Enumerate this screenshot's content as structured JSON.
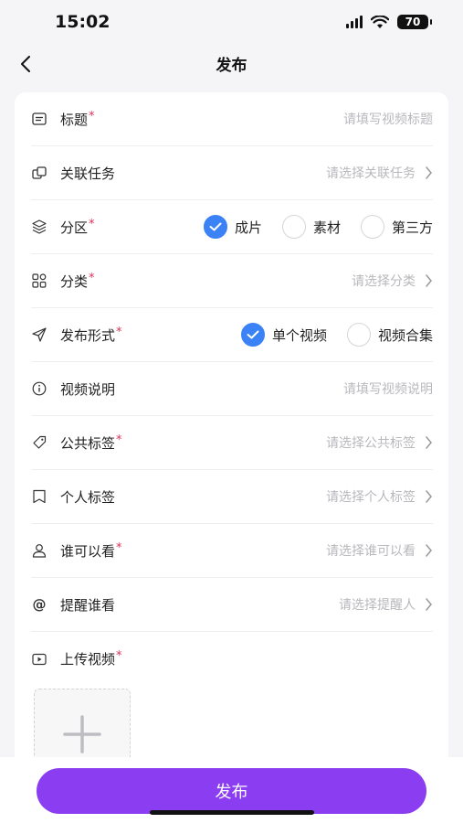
{
  "status_bar": {
    "time": "15:02",
    "battery": "70"
  },
  "nav": {
    "title": "发布"
  },
  "form": {
    "title": {
      "label": "标题",
      "placeholder": "请填写视频标题"
    },
    "task": {
      "label": "关联任务",
      "placeholder": "请选择关联任务"
    },
    "zone": {
      "label": "分区",
      "options": [
        "成片",
        "素材",
        "第三方"
      ],
      "selected": "成片"
    },
    "category": {
      "label": "分类",
      "placeholder": "请选择分类"
    },
    "format": {
      "label": "发布形式",
      "options": [
        "单个视频",
        "视频合集"
      ],
      "selected": "单个视频"
    },
    "description": {
      "label": "视频说明",
      "placeholder": "请填写视频说明"
    },
    "public_tags": {
      "label": "公共标签",
      "placeholder": "请选择公共标签"
    },
    "personal_tags": {
      "label": "个人标签",
      "placeholder": "请选择个人标签"
    },
    "visibility": {
      "label": "谁可以看",
      "placeholder": "请选择谁可以看"
    },
    "mention": {
      "label": "提醒谁看",
      "placeholder": "请选择提醒人",
      "icon": "@"
    },
    "upload": {
      "label": "上传视频"
    }
  },
  "required_mark": "*",
  "footer": {
    "publish_label": "发布"
  },
  "colors": {
    "accent": "#8b3df2",
    "check": "#3b82f6",
    "required": "#e0305a"
  }
}
